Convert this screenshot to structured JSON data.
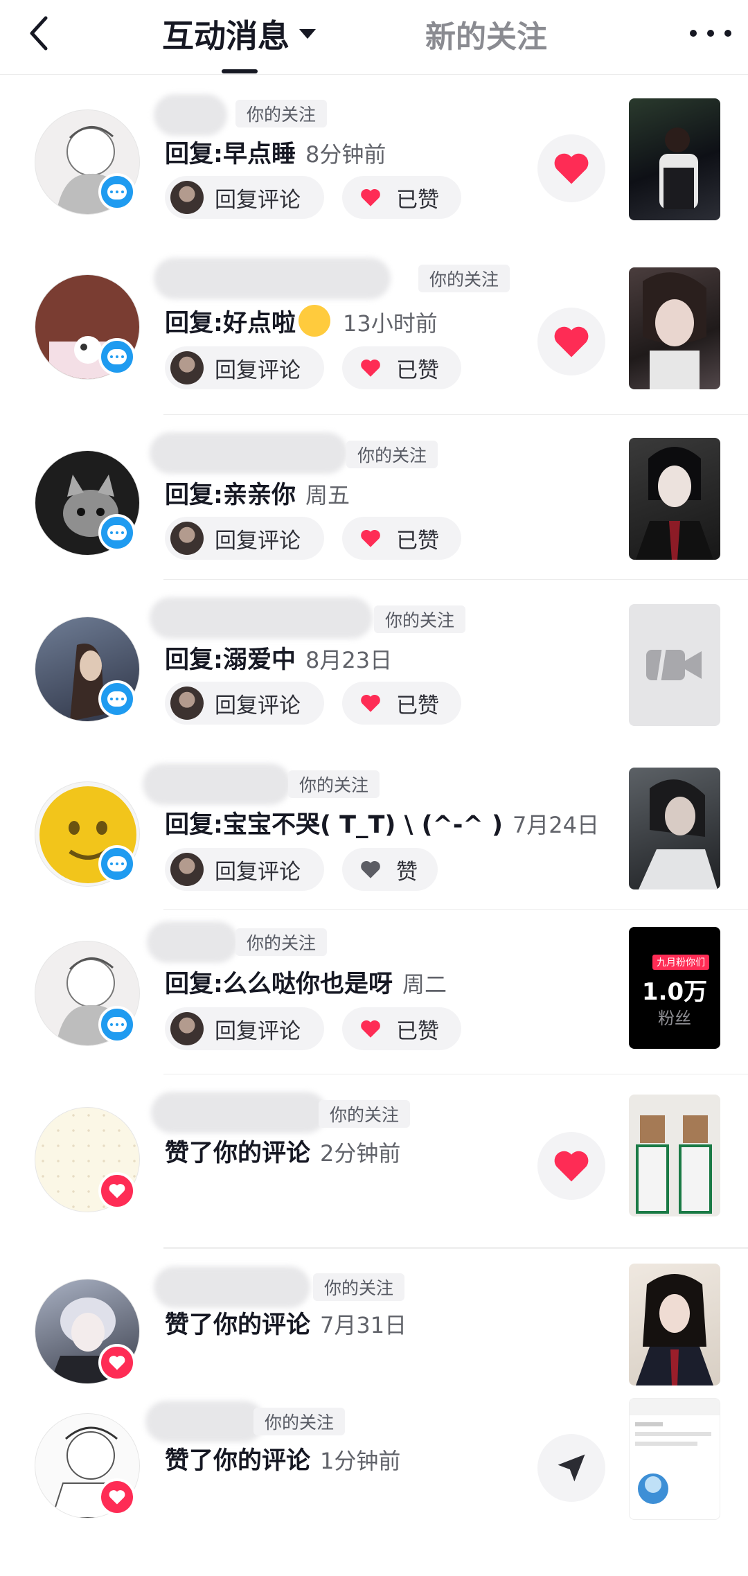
{
  "header": {
    "tab_active": "互动消息",
    "tab_inactive": "新的关注"
  },
  "labels": {
    "following_tag": "你的关注",
    "reply_button": "回复评论",
    "liked": "已赞",
    "like": "赞"
  },
  "items": [
    {
      "prefix": "回复: ",
      "text": "早点睡",
      "time": "8分钟前"
    },
    {
      "prefix": "回复: ",
      "text": "好点啦",
      "emoji": "🤗",
      "time": "13小时前"
    },
    {
      "prefix": "回复: ",
      "text": "亲亲你",
      "time": "周五"
    },
    {
      "prefix": "回复: ",
      "text": "溺爱中",
      "time": "8月23日"
    },
    {
      "prefix": "回复: ",
      "text": "宝宝不哭( T_T) \\ (^-^ )",
      "time": "7月24日"
    },
    {
      "prefix": "回复: ",
      "text": "么么哒你也是呀",
      "time": "周二"
    },
    {
      "text": "赞了你的评论",
      "time": "2分钟前"
    },
    {
      "text": "赞了你的评论",
      "time": "7月31日"
    },
    {
      "text": "赞了你的评论",
      "time": "1分钟前"
    }
  ],
  "thumb_6": {
    "title": "九月粉你们",
    "number": "1.0万",
    "sub": "粉丝"
  },
  "colors": {
    "accent_red": "#fe2c55",
    "badge_blue": "#1f9bf0",
    "text_dark": "#161823"
  }
}
